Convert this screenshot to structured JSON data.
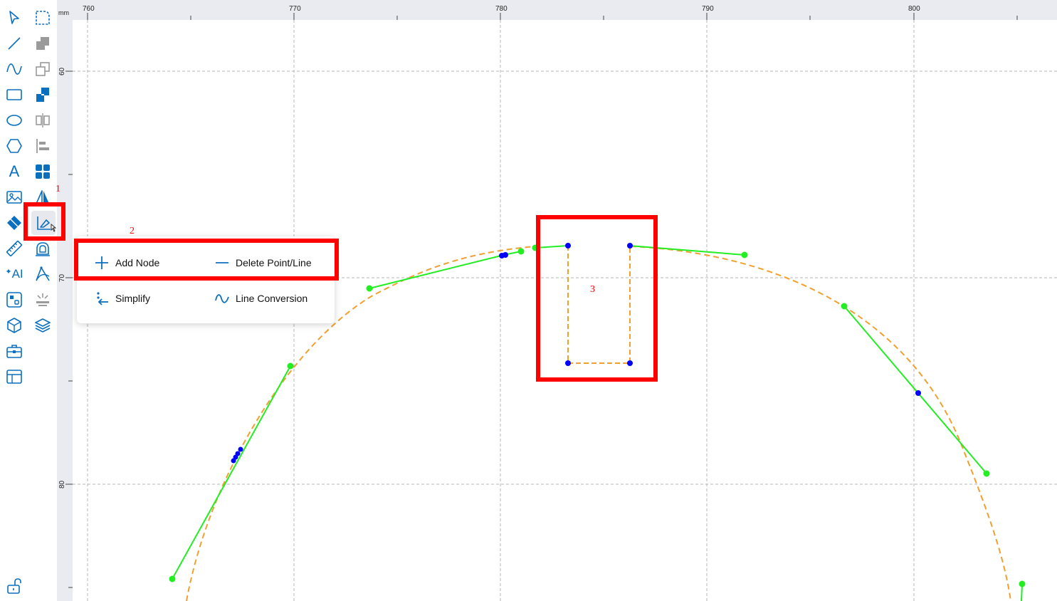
{
  "colors": {
    "icon_blue": "#0b6fbf",
    "icon_gray": "#9a9a9a",
    "highlight_red": "#ff0000",
    "node_blue": "#0000ff",
    "handle_green": "#22ee22",
    "path_orange": "#f0a030",
    "ruler_bg": "#e9ebf0",
    "grid": "#b5b5b5"
  },
  "toolbar": {
    "left_column": [
      {
        "name": "select-icon"
      },
      {
        "name": "line-icon"
      },
      {
        "name": "curve-icon"
      },
      {
        "name": "rectangle-icon"
      },
      {
        "name": "ellipse-icon"
      },
      {
        "name": "polygon-icon"
      },
      {
        "name": "text-icon",
        "glyph": "A"
      },
      {
        "name": "image-icon"
      },
      {
        "name": "eraser-icon"
      },
      {
        "name": "ruler-icon"
      },
      {
        "name": "ai-icon",
        "glyph": "AI"
      },
      {
        "name": "component-icon"
      },
      {
        "name": "cube-icon"
      },
      {
        "name": "toolbox-icon"
      },
      {
        "name": "layout-icon"
      }
    ],
    "right_column": [
      {
        "name": "corner-icon"
      },
      {
        "name": "combine-icon"
      },
      {
        "name": "duplicate-icon"
      },
      {
        "name": "array-icon"
      },
      {
        "name": "mirror-icon"
      },
      {
        "name": "align-left-icon"
      },
      {
        "name": "grid-icon"
      },
      {
        "name": "flip-icon"
      },
      {
        "name": "node-edit-icon"
      },
      {
        "name": "offset-icon"
      },
      {
        "name": "bezier-icon"
      },
      {
        "name": "burst-icon"
      },
      {
        "name": "layers-icon"
      }
    ],
    "lock_icon": "unlock-icon"
  },
  "annotations": {
    "label_1": "1",
    "label_2": "2",
    "label_3": "3"
  },
  "ruler": {
    "unit": "mm",
    "top_labels": [
      "760",
      "770",
      "780",
      "790",
      "800"
    ],
    "left_labels": [
      "60",
      "70",
      "80"
    ]
  },
  "popup": {
    "add_node": "Add Node",
    "delete_point_line": "Delete Point/Line",
    "simplify": "Simplify",
    "line_conversion": "Line Conversion"
  }
}
